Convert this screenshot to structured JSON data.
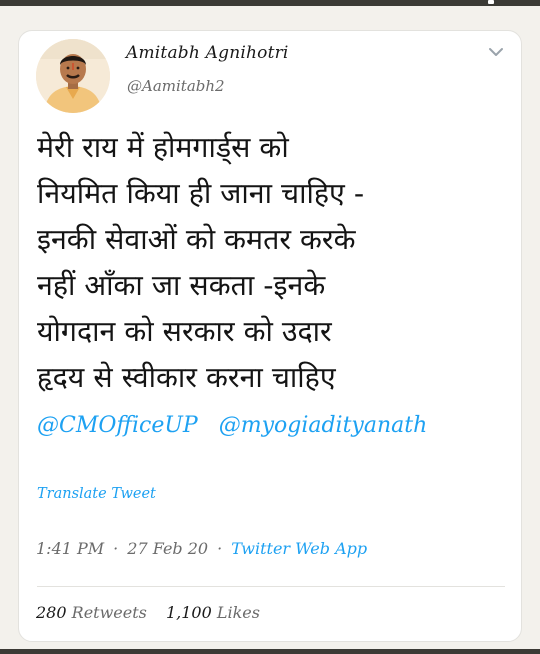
{
  "colors": {
    "link": "#1da1f2",
    "text": "#141414",
    "muted": "#6b6b6b",
    "background": "#f3f1ec",
    "card": "#ffffff"
  },
  "author": {
    "name": "Amitabh Agnihotri",
    "handle": "@Aamitabh2",
    "avatar_icon": "profile-photo"
  },
  "menu_icon": "chevron-down-icon",
  "tweet": {
    "lines": [
      "मेरी राय में होमगार्ड्स को",
      "नियमित किया ही जाना चाहिए -",
      "इनकी सेवाओं को कमतर करके",
      "नहीं आँका जा सकता -इनके",
      "योगदान को सरकार को उदार",
      "हृदय से स्वीकार करना चाहिए"
    ],
    "mentions": [
      "@CMOfficeUP",
      "@myogiadityanath"
    ]
  },
  "translate_label": "Translate Tweet",
  "meta": {
    "time": "1:41 PM",
    "date": "27 Feb 20",
    "separator": "·",
    "source": "Twitter Web App"
  },
  "stats": {
    "retweets_count": "280",
    "retweets_label": "Retweets",
    "likes_count": "1,100",
    "likes_label": "Likes"
  }
}
